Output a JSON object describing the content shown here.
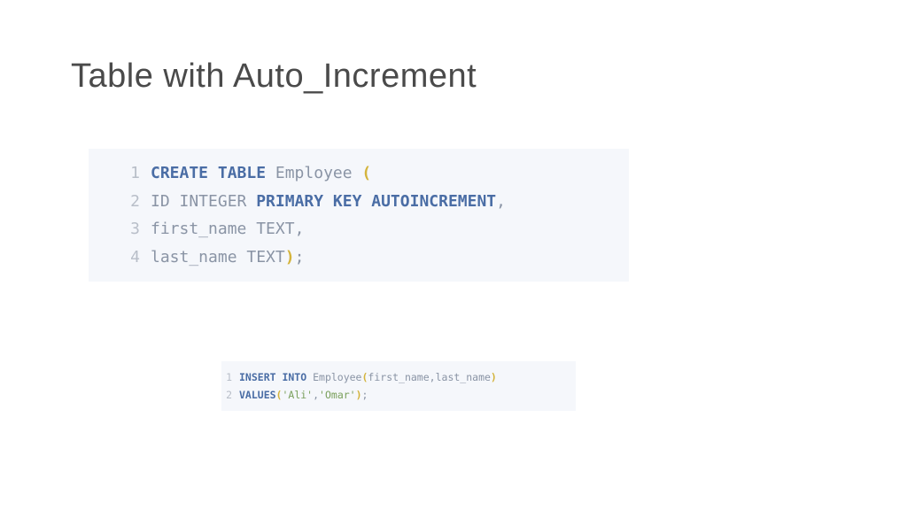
{
  "title": "Table with Auto_Increment",
  "block1": {
    "lines": [
      "1",
      "2",
      "3",
      "4"
    ],
    "t1_kw1": "CREATE TABLE",
    "t1_id1": " Employee ",
    "t1_p1": "(",
    "t2_id1": "ID INTEGER ",
    "t2_kw1": "PRIMARY KEY AUTOINCREMENT",
    "t2_pu1": ",",
    "t3_id1": "first_name TEXT",
    "t3_pu1": ",",
    "t4_id1": "last_name TEXT",
    "t4_p1": ")",
    "t4_pu1": ";"
  },
  "block2": {
    "lines": [
      "1",
      "2"
    ],
    "t1_kw1": "INSERT INTO",
    "t1_id1": " Employee",
    "t1_p1": "(",
    "t1_id2": "first_name",
    "t1_pu1": ",",
    "t1_id3": "last_name",
    "t1_p2": ")",
    "t2_kw1": "VALUES",
    "t2_p1": "(",
    "t2_s1": "'Ali'",
    "t2_pu1": ",",
    "t2_s2": "'Omar'",
    "t2_p2": ")",
    "t2_pu2": ";"
  }
}
